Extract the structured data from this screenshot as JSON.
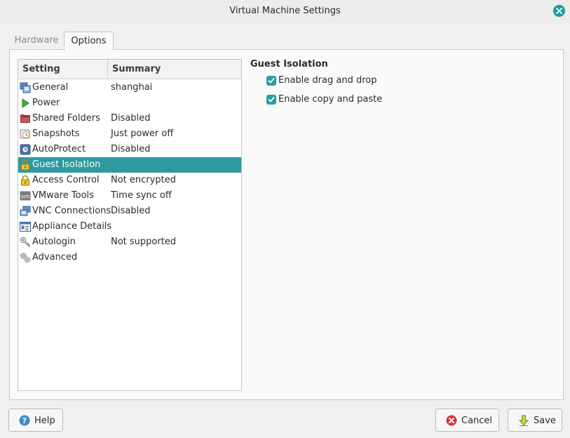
{
  "window": {
    "title": "Virtual Machine Settings"
  },
  "tabs": [
    {
      "label": "Hardware",
      "active": false
    },
    {
      "label": "Options",
      "active": true
    }
  ],
  "list": {
    "headers": {
      "setting": "Setting",
      "summary": "Summary"
    },
    "rows": [
      {
        "icon": "general-icon",
        "name": "General",
        "summary": "shanghai"
      },
      {
        "icon": "power-icon",
        "name": "Power",
        "summary": ""
      },
      {
        "icon": "shared-folders-icon",
        "name": "Shared Folders",
        "summary": "Disabled"
      },
      {
        "icon": "snapshots-icon",
        "name": "Snapshots",
        "summary": "Just power off"
      },
      {
        "icon": "autoprotect-icon",
        "name": "AutoProtect",
        "summary": "Disabled"
      },
      {
        "icon": "lock-icon",
        "name": "Guest Isolation",
        "summary": "",
        "selected": true
      },
      {
        "icon": "lock-icon",
        "name": "Access Control",
        "summary": "Not encrypted"
      },
      {
        "icon": "vmware-tools-icon",
        "name": "VMware Tools",
        "summary": "Time sync off"
      },
      {
        "icon": "vnc-icon",
        "name": "VNC Connections",
        "summary": "Disabled"
      },
      {
        "icon": "appliance-details-icon",
        "name": "Appliance Details",
        "summary": ""
      },
      {
        "icon": "autologin-icon",
        "name": "Autologin",
        "summary": "Not supported"
      },
      {
        "icon": "advanced-icon",
        "name": "Advanced",
        "summary": ""
      }
    ]
  },
  "guest_isolation": {
    "title": "Guest Isolation",
    "options": [
      {
        "label": "Enable drag and drop",
        "checked": true
      },
      {
        "label": "Enable copy and paste",
        "checked": true
      }
    ]
  },
  "buttons": {
    "help": "Help",
    "cancel": "Cancel",
    "save": "Save"
  },
  "colors": {
    "accent": "#2e9aa0",
    "close": "#219a9b",
    "cancel_icon": "#d9343a",
    "help_icon": "#3c88d0"
  }
}
